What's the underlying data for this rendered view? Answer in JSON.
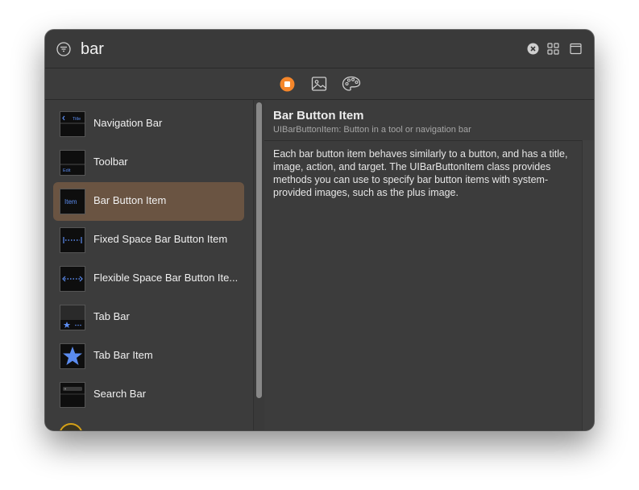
{
  "search": {
    "query": "bar"
  },
  "icons": {
    "filter": "filter-icon",
    "clear": "clear-icon",
    "grid": "grid-view-icon",
    "panel": "panel-icon",
    "objects_tab": "objects-library-icon",
    "media_tab": "media-library-icon",
    "colors_tab": "color-palette-icon"
  },
  "colors": {
    "accent": "#f5862a",
    "selection": "#6a5442",
    "thumb_blue": "#5b8cf0"
  },
  "list": {
    "items": [
      {
        "label": "Navigation Bar",
        "thumb_text": "Title"
      },
      {
        "label": "Toolbar",
        "thumb_text": "Edit"
      },
      {
        "label": "Bar Button Item",
        "thumb_text": "Item",
        "selected": true
      },
      {
        "label": "Fixed Space Bar Button Item"
      },
      {
        "label": "Flexible Space Bar Button Ite..."
      },
      {
        "label": "Tab Bar"
      },
      {
        "label": "Tab Bar Item"
      },
      {
        "label": "Search Bar"
      }
    ]
  },
  "detail": {
    "title": "Bar Button Item",
    "subtitle": "UIBarButtonItem: Button in a tool or navigation bar",
    "description": "Each bar button item behaves similarly to a button, and has a title, image, action, and target. The UIBarButtonItem class provides methods you can use to specify bar button items with system-provided images, such as the plus image."
  }
}
